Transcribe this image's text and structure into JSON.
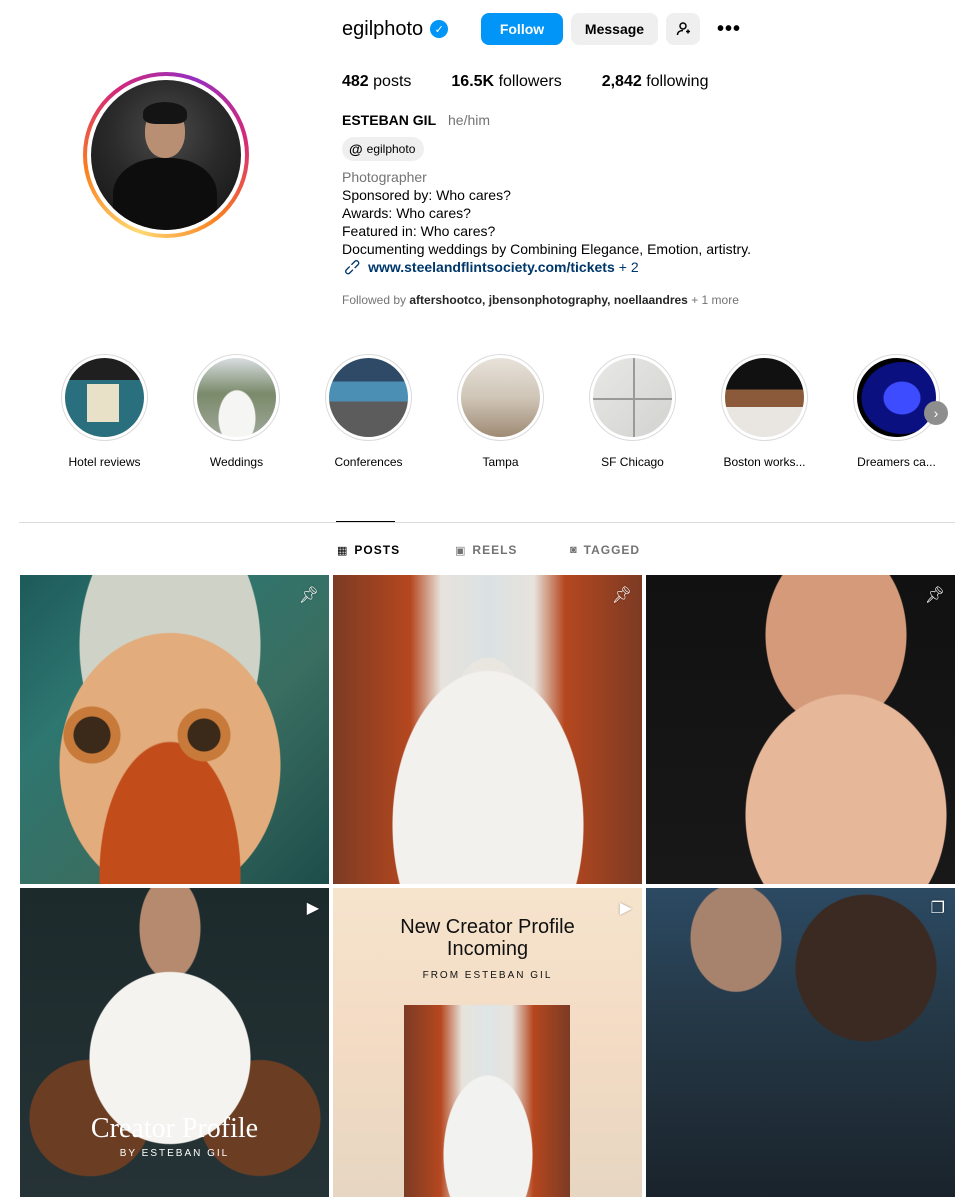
{
  "profile": {
    "username": "egilphoto",
    "verified_icon": "verified-badge-icon",
    "follow_label": "Follow",
    "message_label": "Message",
    "more_label": "•••",
    "stats": {
      "posts_count": "482",
      "posts_label": "posts",
      "followers_count": "16.5K",
      "followers_label": "followers",
      "following_count": "2,842",
      "following_label": "following"
    },
    "full_name": "ESTEBAN GIL",
    "pronouns": "he/him",
    "threads_handle": "egilphoto",
    "bio": {
      "category": "Photographer",
      "line1": "Sponsored by: Who cares?",
      "line2": "Awards: Who cares?",
      "line3": "Featured in: Who cares?",
      "line4": "Documenting weddings by Combining Elegance, Emotion, artistry.",
      "link": "www.steelandflintsociety.com/tickets",
      "link_extra": "+ 2"
    },
    "followed_by": {
      "prefix": "Followed by",
      "names": "aftershootco, jbensonphotography, noellaandres",
      "more": "+ 1 more"
    }
  },
  "highlights": [
    {
      "label": "Hotel reviews"
    },
    {
      "label": "Weddings"
    },
    {
      "label": "Conferences"
    },
    {
      "label": "Tampa"
    },
    {
      "label": "SF Chicago"
    },
    {
      "label": "Boston works..."
    },
    {
      "label": "Dreamers ca..."
    }
  ],
  "tabs": {
    "posts": "POSTS",
    "reels": "REELS",
    "tagged": "TAGGED"
  },
  "posts": [
    {
      "badge": "pin-icon"
    },
    {
      "badge": "pin-icon"
    },
    {
      "badge": "pin-icon"
    },
    {
      "badge": "reel-icon",
      "overlay_title": "Creator Profile",
      "overlay_sub": "BY ESTEBAN GIL"
    },
    {
      "badge": "reel-icon",
      "overlay_title": "New Creator Profile Incoming",
      "overlay_sub": "FROM ESTEBAN GIL"
    },
    {
      "badge": "carousel-icon"
    }
  ],
  "colors": {
    "accent": "#0095f6",
    "link": "#00376b",
    "secondary_text": "#737373",
    "divider": "#dbdbdb"
  }
}
